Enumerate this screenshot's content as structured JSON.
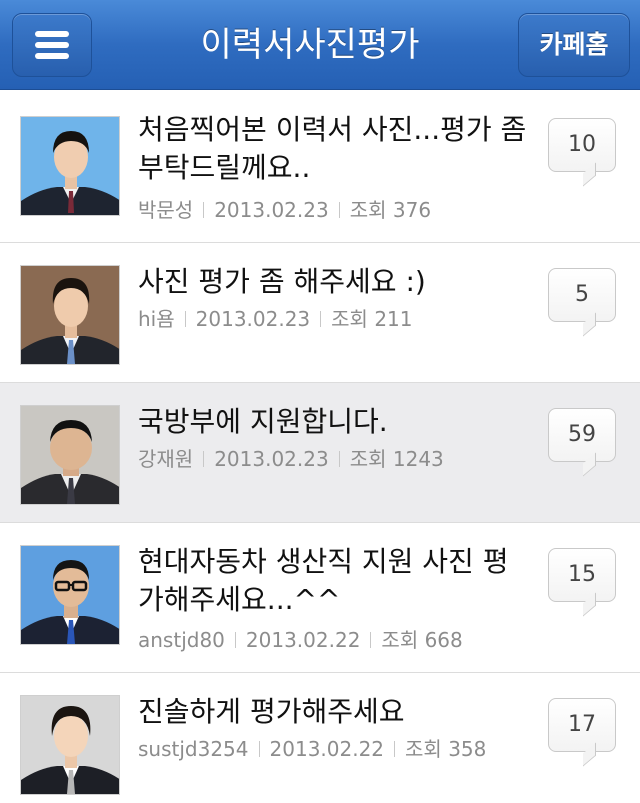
{
  "header": {
    "title": "이력서사진평가",
    "menu_icon": "menu-icon",
    "cafe_home_label": "카페홈",
    "bar_color": "#2f6cc0"
  },
  "posts": [
    {
      "title": "처음찍어본 이력서 사진...평가 좀부탁드릴께요..",
      "author": "박문성",
      "date": "2013.02.23",
      "views": "조회 376",
      "comments": "10",
      "avatar_icon": "profile-photo-blue-background"
    },
    {
      "title": "사진 평가 좀 해주세요 :)",
      "author": "hi욤",
      "date": "2013.02.23",
      "views": "조회 211",
      "comments": "5",
      "avatar_icon": "profile-photo-brown-background"
    },
    {
      "title": "국방부에 지원합니다.",
      "author": "강재원",
      "date": "2013.02.23",
      "views": "조회 1243",
      "comments": "59",
      "avatar_icon": "profile-photo-gray-background"
    },
    {
      "title": "현대자동차 생산직 지원 사진 평가해주세요...^^",
      "author": "anstjd80",
      "date": "2013.02.22",
      "views": "조회 668",
      "comments": "15",
      "avatar_icon": "profile-photo-blue-background"
    },
    {
      "title": "진솔하게 평가해주세요",
      "author": "sustjd3254",
      "date": "2013.02.22",
      "views": "조회 358",
      "comments": "17",
      "avatar_icon": "profile-photo-gray-background"
    }
  ]
}
